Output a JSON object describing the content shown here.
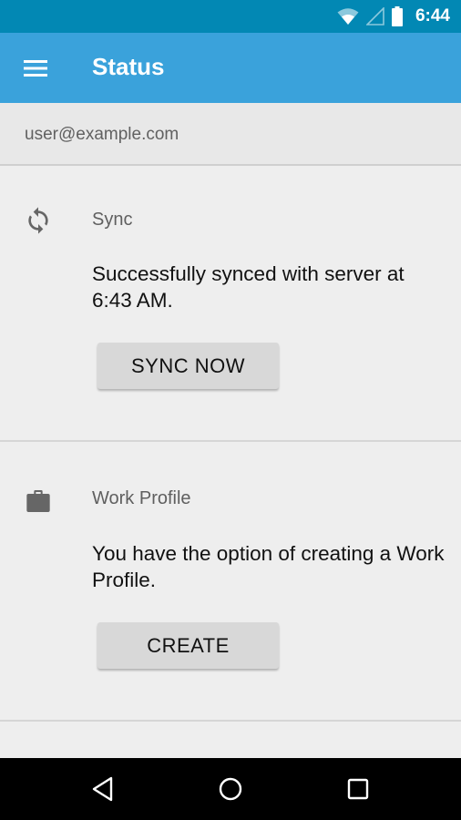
{
  "status_bar": {
    "time": "6:44",
    "icons": [
      "wifi-icon",
      "cellular-signal-icon",
      "battery-icon"
    ]
  },
  "app_bar": {
    "title": "Status",
    "menu_icon": "hamburger-menu-icon",
    "color": "#3aa2db"
  },
  "account": {
    "email": "user@example.com"
  },
  "sections": [
    {
      "icon": "sync-icon",
      "title": "Sync",
      "description": "Successfully synced with server at 6:43 AM.",
      "button_label": "SYNC NOW"
    },
    {
      "icon": "briefcase-icon",
      "title": "Work Profile",
      "description": "You have the option of creating a Work Profile.",
      "button_label": "CREATE"
    }
  ],
  "nav_bar": {
    "back": "back-icon",
    "home": "home-icon",
    "recents": "recents-icon"
  }
}
